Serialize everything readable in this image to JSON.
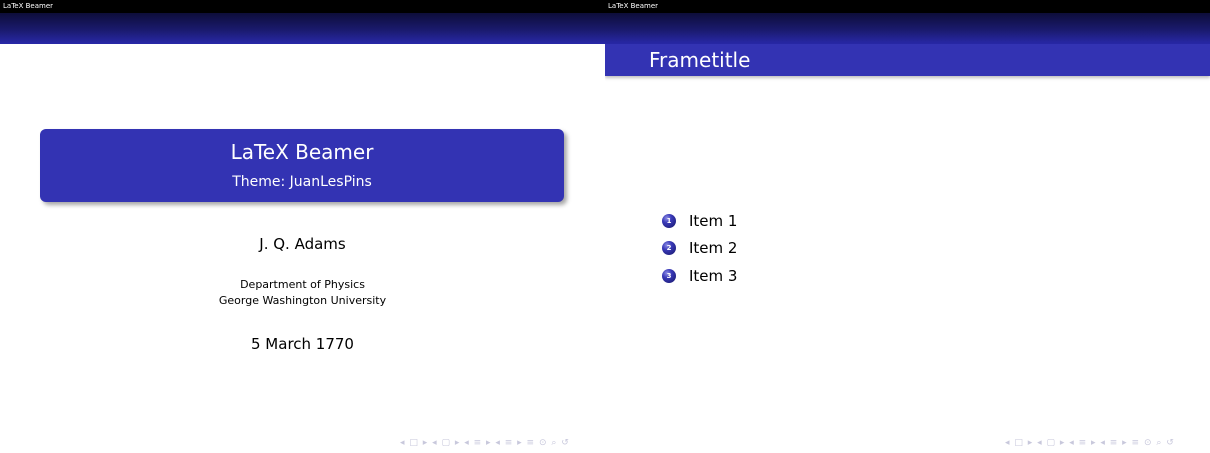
{
  "slides": [
    {
      "headline": "LaTeX Beamer",
      "title": "LaTeX Beamer",
      "subtitle": "Theme: JuanLesPins",
      "author": "J. Q. Adams",
      "institute_line1": "Department of Physics",
      "institute_line2": "George Washington University",
      "date": "5 March 1770",
      "nav_symbols": "◂ □ ▸ ◂ ▢ ▸ ◂ ≡ ▸ ◂ ≡ ▸ ≡ ⊙ ⌕ ↺"
    },
    {
      "headline": "LaTeX Beamer",
      "frametitle": "Frametitle",
      "items": [
        {
          "number": "1",
          "text": "Item 1"
        },
        {
          "number": "2",
          "text": "Item 2"
        },
        {
          "number": "3",
          "text": "Item 3"
        }
      ],
      "nav_symbols": "◂ □ ▸ ◂ ▢ ▸ ◂ ≡ ▸ ◂ ≡ ▸ ≡ ⊙ ⌕ ↺"
    }
  ],
  "colors": {
    "structure_blue": "#3333b3",
    "headline_black": "#000000"
  }
}
